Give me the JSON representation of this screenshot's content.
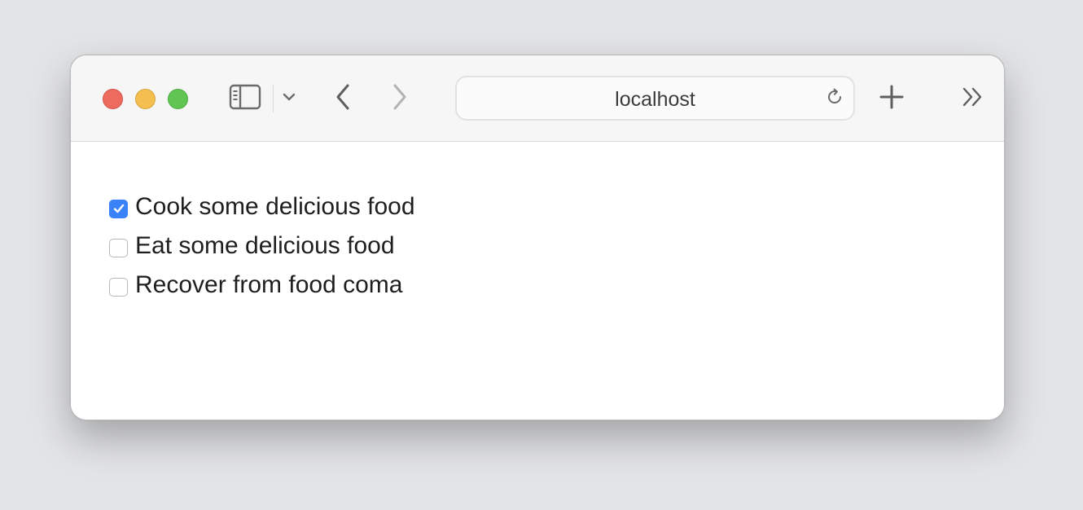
{
  "browser": {
    "address": "localhost",
    "icons": {
      "close": "close-traffic-light",
      "minimize": "minimize-traffic-light",
      "zoom": "zoom-traffic-light",
      "sidebar": "sidebar-icon",
      "sidebar_menu": "chevron-down-icon",
      "back": "chevron-left-icon",
      "forward": "chevron-right-icon",
      "reload": "reload-icon",
      "new_tab": "plus-icon",
      "more": "double-chevron-right-icon"
    },
    "colors": {
      "close": "#ec6a5e",
      "minimize": "#f4bf4f",
      "zoom": "#61c554",
      "checkbox_accent": "#3a82f7"
    }
  },
  "todos": [
    {
      "label": "Cook some delicious food",
      "checked": true
    },
    {
      "label": "Eat some delicious food",
      "checked": false
    },
    {
      "label": "Recover from food coma",
      "checked": false
    }
  ]
}
